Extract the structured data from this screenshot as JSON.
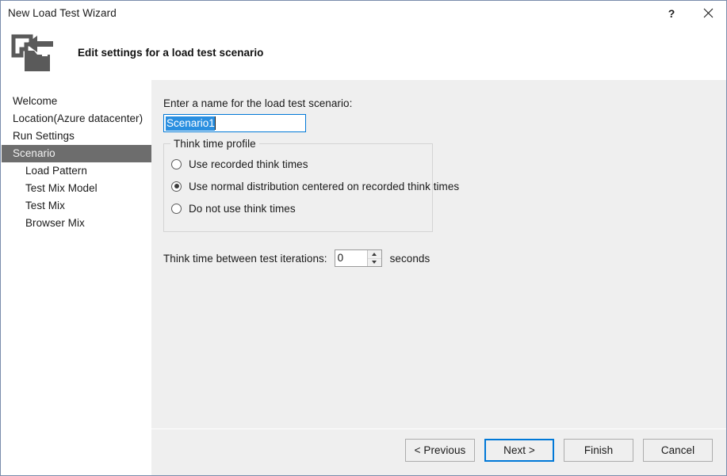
{
  "window": {
    "title": "New Load Test Wizard",
    "help_label": "?",
    "close_label": "✕"
  },
  "header": {
    "title": "Edit settings for a load test scenario",
    "icon": "import-folder-icon"
  },
  "sidebar": {
    "items": [
      {
        "label": "Welcome",
        "level": 0,
        "selected": false
      },
      {
        "label": "Location(Azure datacenter)",
        "level": 0,
        "selected": false
      },
      {
        "label": "Run Settings",
        "level": 0,
        "selected": false
      },
      {
        "label": "Scenario",
        "level": 0,
        "selected": true
      },
      {
        "label": "Load Pattern",
        "level": 1,
        "selected": false
      },
      {
        "label": "Test Mix Model",
        "level": 1,
        "selected": false
      },
      {
        "label": "Test Mix",
        "level": 1,
        "selected": false
      },
      {
        "label": "Browser Mix",
        "level": 1,
        "selected": false
      }
    ]
  },
  "main": {
    "name_label": "Enter a name for the load test scenario:",
    "name_value": "Scenario1",
    "name_selected": true,
    "groupbox": {
      "title": "Think time profile",
      "options": [
        {
          "label": "Use recorded think times",
          "checked": false
        },
        {
          "label": "Use normal distribution centered on recorded think times",
          "checked": true
        },
        {
          "label": "Do not use think times",
          "checked": false
        }
      ]
    },
    "think_time": {
      "label": "Think time between test iterations:",
      "value": "0",
      "unit": "seconds"
    }
  },
  "footer": {
    "buttons": [
      {
        "label": "< Previous",
        "default": false
      },
      {
        "label": "Next >",
        "default": true
      },
      {
        "label": "Finish",
        "default": false
      },
      {
        "label": "Cancel",
        "default": false
      }
    ]
  },
  "colors": {
    "accent": "#0078d7",
    "selection": "#2a8fe0",
    "nav_selected_bg": "#6d6d6d",
    "panel_bg": "#efefef",
    "window_border": "#7a8cab"
  }
}
